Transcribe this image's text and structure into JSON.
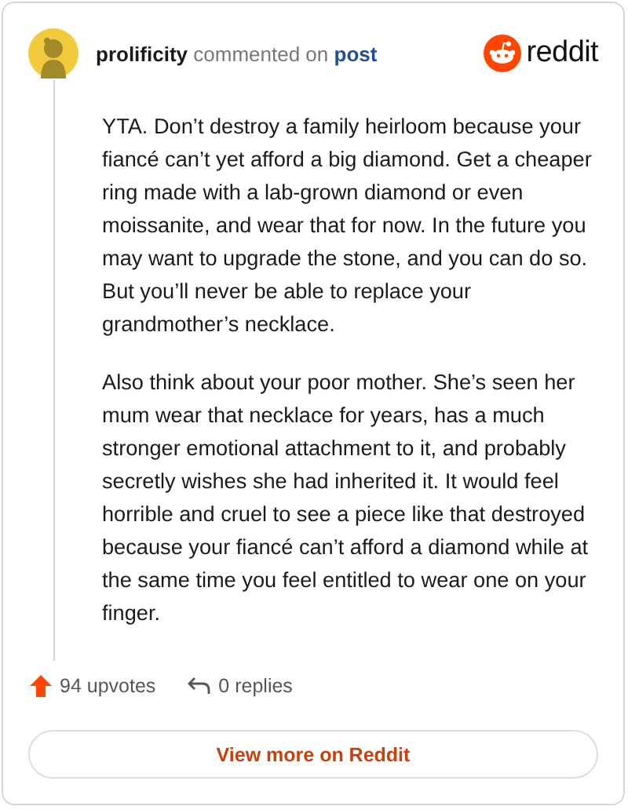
{
  "header": {
    "username": "prolificity",
    "action": "commented on",
    "link": "post",
    "brand": "reddit"
  },
  "comment": {
    "paragraphs": [
      "YTA. Don’t destroy a family heirloom because your fiancé can’t yet afford a big diamond. Get a cheaper ring made with a lab-grown diamond or even moissanite, and wear that for now. In the future you may want to upgrade the stone, and you can do so. But you’ll never be able to replace your grandmother’s necklace.",
      "Also think about your poor mother. She’s seen her mum wear that necklace for years, has a much stronger emotional attachment to it, and probably secretly wishes she had inherited it. It would feel horrible and cruel to see a piece like that destroyed because your fiancé can’t afford a diamond while at the same time you feel entitled to wear one on your finger."
    ]
  },
  "stats": {
    "upvotes": "94 upvotes",
    "replies": "0 replies"
  },
  "button": "View more on Reddit"
}
